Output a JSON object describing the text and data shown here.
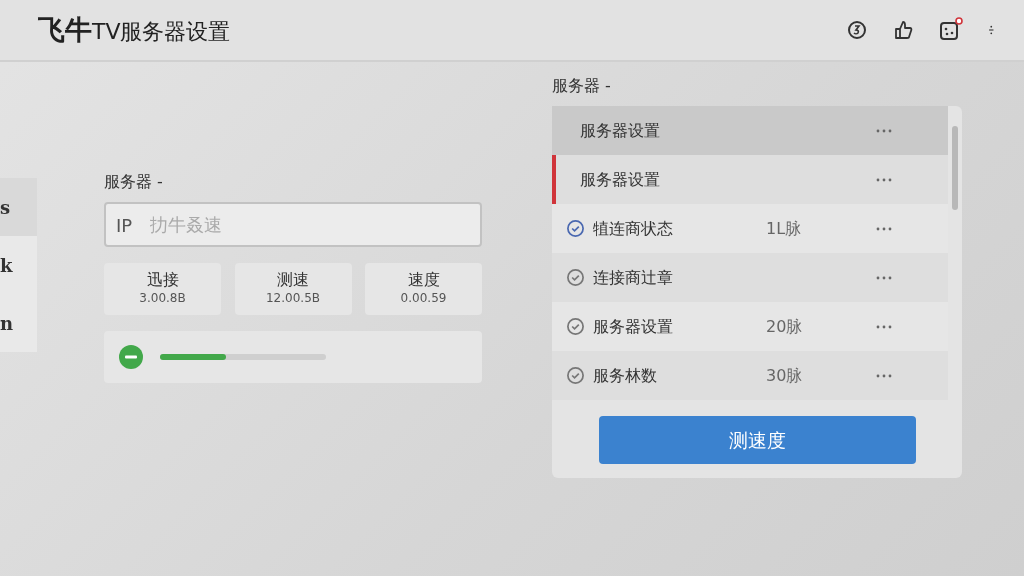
{
  "header": {
    "title": "**飞牛**TV服务器设置",
    "notification_dot": true
  },
  "sidebar": {
    "items": [
      {
        "label": "s",
        "selected": true
      },
      {
        "label": "k",
        "selected": false
      },
      {
        "label": "n",
        "selected": false
      }
    ]
  },
  "server_panel": {
    "label": "服务器 -",
    "field": {
      "prefix": "IP",
      "placeholder": "扐牛叒速"
    },
    "stats": [
      {
        "label": "迅接",
        "value": "3.00.8B"
      },
      {
        "label": "测速",
        "value": "12.00.5B"
      },
      {
        "label": "速度",
        "value": "0.00.59"
      }
    ],
    "progress": {
      "level": 0.4
    }
  },
  "server_list": {
    "label": "服务器 -",
    "rows": [
      {
        "kind": "plain",
        "label": "服务器设置",
        "selected": true,
        "flagged": false
      },
      {
        "kind": "plain",
        "label": "服务器设置",
        "selected": false,
        "flagged": true
      },
      {
        "kind": "check",
        "label": "犆连商状态",
        "value": "1L脉",
        "active": true,
        "selected": false,
        "flagged": false
      },
      {
        "kind": "check",
        "label": "连接商辻章",
        "active": false,
        "selected": false,
        "flagged": false
      },
      {
        "kind": "check",
        "label": "服务器设置",
        "value": "20脉",
        "active": false,
        "selected": false,
        "flagged": false
      },
      {
        "kind": "check",
        "label": "服务林数",
        "value": "30脉",
        "active": false,
        "selected": false,
        "flagged": false
      }
    ],
    "button": "测速度"
  }
}
